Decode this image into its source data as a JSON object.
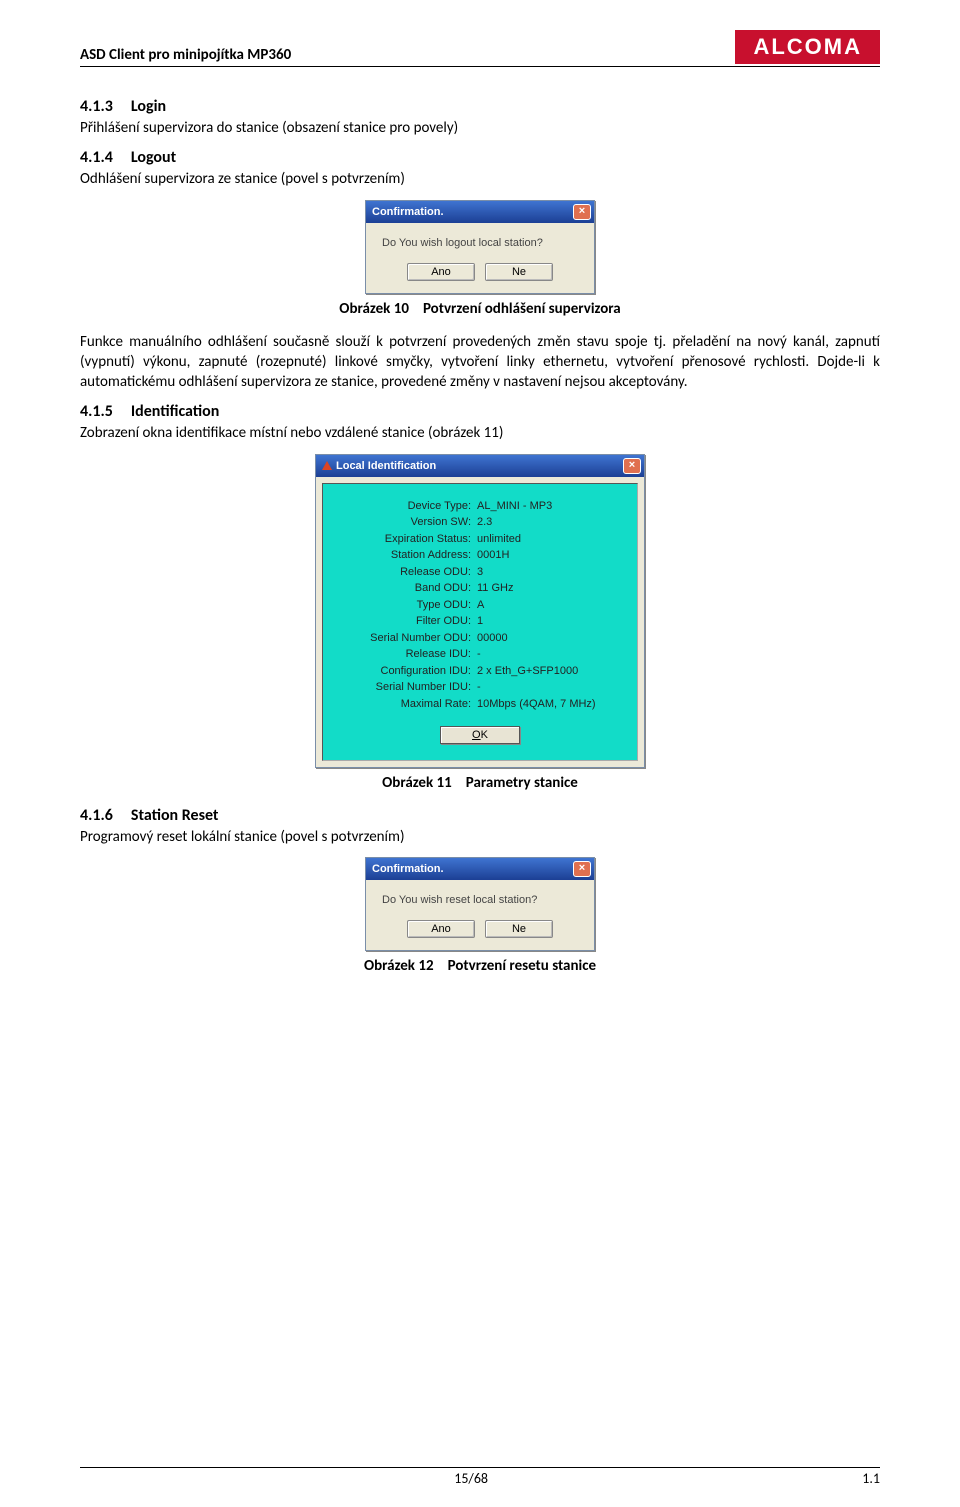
{
  "header": {
    "title": "ASD Client pro minipojítka MP360",
    "logo_text": "ALCOMA"
  },
  "s413": {
    "num": "4.1.3",
    "title": "Login",
    "text": "Přihlášení supervizora do stanice (obsazení stanice pro povely)"
  },
  "s414": {
    "num": "4.1.4",
    "title": "Logout",
    "text": "Odhlášení supervizora ze stanice (povel s potvrzením)"
  },
  "fig10": {
    "dialog": {
      "title": "Confirmation.",
      "question": "Do You wish logout local station?",
      "btn_yes": "Ano",
      "btn_no": "Ne"
    },
    "label": "Obrázek 10",
    "caption": "Potvrzení odhlášení supervizora"
  },
  "para414": "Funkce manuálního odhlášení současně slouží k potvrzení provedených změn stavu spoje tj. přeladění na nový kanál, zapnutí (vypnutí) výkonu, zapnuté (rozepnuté) linkové smyčky, vytvoření linky ethernetu, vytvoření přenosové rychlosti. Dojde-li k automatickému odhlášení supervizora ze stanice, provedené změny v nastavení nejsou akceptovány.",
  "s415": {
    "num": "4.1.5",
    "title": "Identification",
    "text": "Zobrazení okna identifikace místní nebo vzdálené stanice (obrázek 11)"
  },
  "fig11": {
    "dialog": {
      "title": "Local Identification",
      "rows": [
        {
          "label": "Device Type:",
          "val": "AL_MINI - MP3"
        },
        {
          "label": "Version SW:",
          "val": "2.3"
        },
        {
          "label": "Expiration Status:",
          "val": "unlimited"
        },
        {
          "label": "Station Address:",
          "val": "0001H"
        },
        {
          "label": "Release ODU:",
          "val": "3"
        },
        {
          "label": "Band ODU:",
          "val": "11 GHz"
        },
        {
          "label": "Type ODU:",
          "val": "A"
        },
        {
          "label": "Filter ODU:",
          "val": "1"
        },
        {
          "label": "Serial Number ODU:",
          "val": "00000"
        },
        {
          "label": "Release IDU:",
          "val": "-"
        },
        {
          "label": "Configuration IDU:",
          "val": "2 x Eth_G+SFP1000"
        },
        {
          "label": "Serial Number IDU:",
          "val": "-"
        },
        {
          "label": "Maximal Rate:",
          "val": "10Mbps (4QAM, 7 MHz)"
        }
      ],
      "ok_prefix": "O",
      "ok_rest": "K"
    },
    "label": "Obrázek 11",
    "caption": "Parametry stanice"
  },
  "s416": {
    "num": "4.1.6",
    "title": "Station Reset",
    "text": "Programový reset lokální stanice (povel s potvrzením)"
  },
  "fig12": {
    "dialog": {
      "title": "Confirmation.",
      "question": "Do You wish reset local station?",
      "btn_yes": "Ano",
      "btn_no": "Ne"
    },
    "label": "Obrázek 12",
    "caption": "Potvrzení resetu stanice"
  },
  "footer": {
    "page": "15/68",
    "ver": "1.1"
  }
}
